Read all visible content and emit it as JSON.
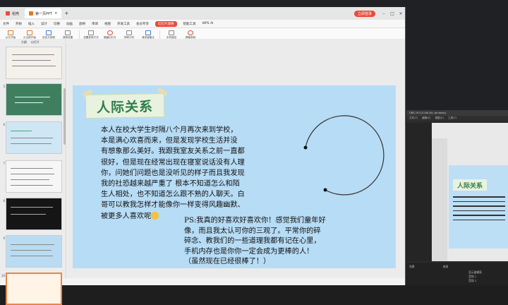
{
  "tabs": [
    {
      "label": "稻壳",
      "active": false
    },
    {
      "label": "第一页PPT",
      "active": true
    }
  ],
  "titlebar": {
    "login_label": "立即登录"
  },
  "menu": [
    "文件",
    "开始",
    "插入",
    "设计",
    "切换",
    "动画",
    "放映",
    "审阅",
    "视图",
    "开发工具",
    "会员专享",
    "幻灯片放映",
    "智能工具",
    "WPS AI"
  ],
  "menu_active_index": 11,
  "ribbon": [
    {
      "label": "从头开始",
      "icon": "play-icon"
    },
    {
      "label": "从当前开始",
      "icon": "play-current-icon"
    },
    {
      "label": "自定义放映",
      "icon": "custom-show-icon"
    },
    {
      "label": "放映设置",
      "icon": "settings-icon"
    },
    {
      "label": "设置放映方式",
      "icon": "mode-icon"
    },
    {
      "label": "隐藏幻灯片",
      "icon": "hide-icon"
    },
    {
      "label": "排练计时",
      "icon": "timer-icon"
    },
    {
      "label": "演讲者备注",
      "icon": "notes-icon"
    },
    {
      "label": "手机遥控",
      "icon": "phone-icon"
    },
    {
      "label": "屏幕录制",
      "icon": "record-icon"
    }
  ],
  "sidebar": {
    "tabs": [
      "大纲",
      "幻灯片"
    ],
    "slide_numbers": [
      "",
      "5",
      "6",
      "7",
      "8",
      "9",
      "10"
    ]
  },
  "slide": {
    "title": "人际关系",
    "body": "本人在校大学生时隔八个月再次来到学校，\n本是满心欢喜而来，但是发现学校生活并没\n有想象那么美好。我跟我室友关系之前一直都\n很好，但是现在经常出现在寝室说话没有人理\n你，问她们问题也是没听见的样子而且我发现\n我的社恐越来越严重了 根本不知道怎么和陌\n生人相处，也不知道怎么跟不熟的人聊天。白\n哥可以教我怎样才能像你一样变得风趣幽默、\n被更多人喜欢呢",
    "ps": "PS:我真的好喜欢好喜欢你！感觉我们童年好\n像，而且我太认可你的三观了。平常你的碎\n碎念、教我们的一些道理我都有记在心里，\n手机内存也是你你一定会成为更棒的人！\n（虽然现在已经很棒了！）"
  },
  "preview": {
    "title": "OBS 29.0.0 (64-bit, windows)",
    "menu": [
      "文件(F)",
      "编辑(E)",
      "视图(V)",
      "工具(T)"
    ],
    "slide_title": "人际关系",
    "bottom_labels": [
      "场景",
      "来源",
      "显示器捕获",
      "音频 1",
      "音频 2"
    ]
  }
}
